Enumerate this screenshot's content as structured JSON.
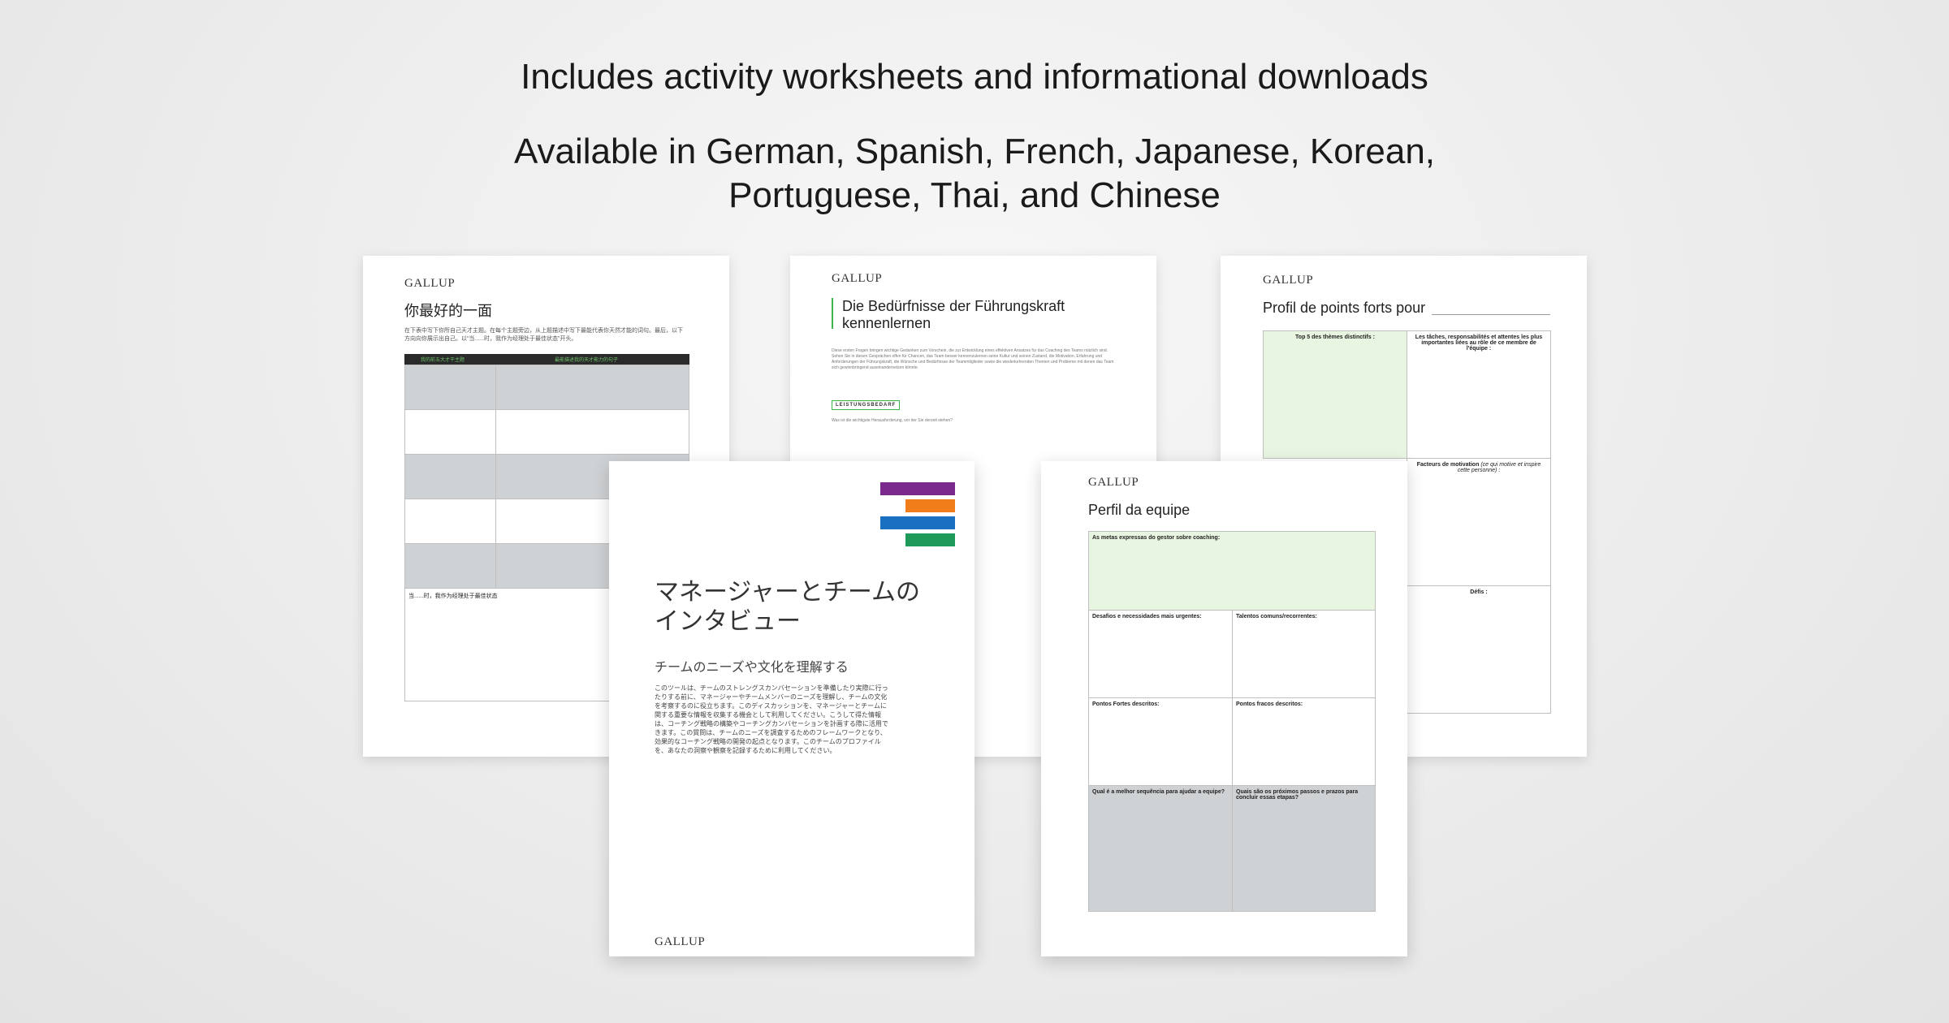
{
  "headline": "Includes activity worksheets and informational downloads",
  "subheadline_line1": "Available in German, Spanish, French, Japanese, Korean,",
  "subheadline_line2": "Portuguese, Thai, and Chinese",
  "logo": "GALLUP",
  "chinese_page": {
    "title": "你最好的一面",
    "intro": "在下表中写下你所自己天才主题。在每个主题旁边，从上题描述中写下最能代表你天然才能的词句。最后，以下方向向你展示出自己。以“当......时，我作为经理处于最佳状态”开头。",
    "col1": "我的前五大才干主题",
    "col2": "最能描述我的天才能力的句子",
    "footer_prompt": "当......时，我作为经理处于最佳状态"
  },
  "german_page": {
    "title_line1": "Die Bedürfnisse der Führungskraft",
    "title_line2": "kennenlernen",
    "body": "Diese ersten Fragen bringen wichtige Gedanken zum Vorschein, die zur Entwicklung eines effektiven Ansatzes für das Coaching des Teams nützlich sind. Sehen Sie in diesen Gesprächen offen für Chancen, das Team besser kennenzulernen seine Kultur und seinen Zustand, die Motivation, Erfahrung und Anforderungen der Führungskraft, die Wünsche und Bedürfnisse der Teammitglieder sowie die wiederkehrenden Themen und Probleme mit denen das Team sich gewinnbringend auseinandersetzen könnte.",
    "badge": "LEISTUNGSBEDARF",
    "question": "Was ist die wichtigste Herausforderung, vor der Sie derzeit stehen?"
  },
  "french_page": {
    "title": "Profil de points forts pour",
    "col1": "Top 5 des thèmes distinctifs :",
    "col2": "Les tâches, responsabilités et attentes les plus importantes liées au rôle de ce membre de l'équipe :",
    "motivation_bold": "Facteurs de motivation",
    "motivation_rest": "(ce qui motive et inspire cette personne) :",
    "defis": "Défis :"
  },
  "japanese_page": {
    "title_line1": "マネージャーとチームの",
    "title_line2": "インタビュー",
    "subtitle": "チームのニーズや文化を理解する",
    "body": "このツールは、チームのストレングスカンバセーションを準備したり実際に行ったりする前に、マネージャーやチームメンバーのニーズを理解し、チームの文化を考察するのに役立ちます。このディスカッションを、マネージャーとチームに関する重要な情報を収集する機会として利用してください。こうして得た情報は、コーチング戦略の構築やコーチングカンバセーションを計画する際に活用できます。この質問は、チームのニーズを調査するためのフレームワークとなり、効果的なコーチング戦略の開発の起点となります。このチームのプロファイルを、あなたの洞察や観察を記録するために利用してください。",
    "brand_colors": [
      "#7a2a8c",
      "#f07d1a",
      "#1a6fc2",
      "#1f9a5b"
    ]
  },
  "portuguese_page": {
    "title": "Perfil da equipe",
    "goals": "As metas expressas do gestor sobre coaching:",
    "challenges": "Desafios e necessidades mais urgentes:",
    "talents": "Talentos comuns/recorrentes:",
    "strengths": "Pontos Fortes descritos:",
    "weaknesses": "Pontos fracos descritos:",
    "sequence": "Qual é a melhor sequência para ajudar a equipe?",
    "next_steps": "Quais são os próximos passos e prazos para concluir essas etapas?"
  }
}
